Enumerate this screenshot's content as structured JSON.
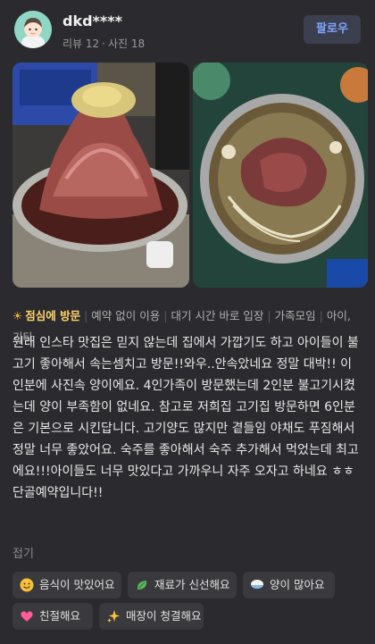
{
  "user": {
    "name": "dkd****",
    "review_count": "리뷰 12",
    "photo_count": "사진 18",
    "follow_label": "팔로우"
  },
  "photos": [
    {
      "subject": "bulgogi-meat-pile"
    },
    {
      "subject": "bulgogi-hotpot"
    }
  ],
  "visit": {
    "time": "점심에 방문",
    "tags": [
      "예약 없이 이용",
      "대기 시간 바로 입장",
      "가족모임",
      "아이, 기타"
    ]
  },
  "review": {
    "text": "원래 인스타 맛집은 믿지 않는데 집에서 가깝기도 하고 아이들이 불고기 좋아해서 속는셈치고 방문!!와우..안속았네요 정말 대박!! 이인분에 사진속 양이에요. 4인가족이 방문했는데 2인분 불고기시켰는데 양이 부족함이 없네요. 참고로 저희집 고기집 방문하면 6인분은 기본으로 시킨답니다. 고기양도 많지만 곁들임 야채도 푸짐해서 정말 너무 좋았어요. 숙주를 좋아해서 숙주 추가해서 먹었는데 최고에요!!!아이들도 너무 맛있다고 가까우니 자주 오자고 하네요 ㅎㅎ단골예약입니다!!",
    "collapse_label": "접기"
  },
  "keywords": [
    {
      "label": "음식이 맛있어요",
      "icon": "smile-emoji-icon"
    },
    {
      "label": "재료가 신선해요",
      "icon": "leaf-icon"
    },
    {
      "label": "양이 많아요",
      "icon": "rice-bowl-icon"
    },
    {
      "label": "친절해요",
      "icon": "heart-icon"
    },
    {
      "label": "매장이 청결해요",
      "icon": "sparkle-icon"
    }
  ],
  "colors": {
    "background": "#2b2b2f",
    "accent": "#7fa6ff",
    "highlight": "#ffd36a"
  }
}
